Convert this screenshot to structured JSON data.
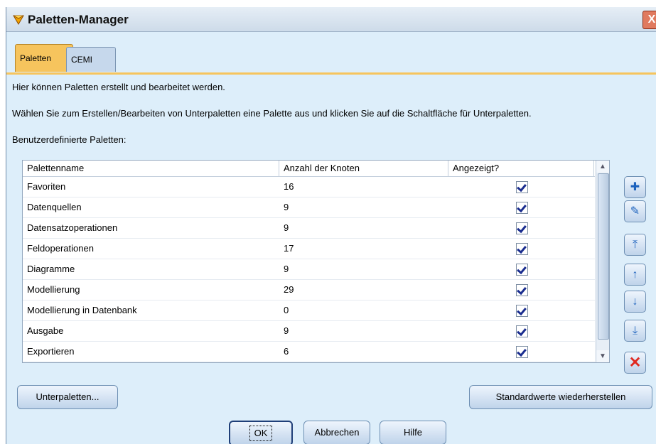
{
  "window": {
    "title": "Paletten-Manager",
    "close_label": "X"
  },
  "tabs": [
    {
      "label": "Paletten"
    },
    {
      "label": "CEMI"
    }
  ],
  "description": {
    "line1": "Hier können Paletten erstellt und bearbeitet werden.",
    "line2": "Wählen Sie zum Erstellen/Bearbeiten von Unterpaletten eine Palette aus und klicken Sie auf die Schaltfläche für Unterpaletten.",
    "custom_label": "Benutzerdefinierte Paletten:"
  },
  "table": {
    "columns": [
      "Palettenname",
      "Anzahl der Knoten",
      "Angezeigt?"
    ],
    "rows": [
      {
        "name": "Favoriten",
        "count": "16",
        "shown": true
      },
      {
        "name": "Datenquellen",
        "count": "9",
        "shown": true
      },
      {
        "name": "Datensatzoperationen",
        "count": "9",
        "shown": true
      },
      {
        "name": "Feldoperationen",
        "count": "17",
        "shown": true
      },
      {
        "name": "Diagramme",
        "count": "9",
        "shown": true
      },
      {
        "name": "Modellierung",
        "count": "29",
        "shown": true
      },
      {
        "name": "Modellierung in Datenbank",
        "count": "0",
        "shown": true
      },
      {
        "name": "Ausgabe",
        "count": "9",
        "shown": true
      },
      {
        "name": "Exportieren",
        "count": "6",
        "shown": true
      }
    ]
  },
  "side_buttons": [
    {
      "name": "add-palette-icon",
      "glyph": "✚"
    },
    {
      "name": "edit-palette-icon",
      "glyph": "✎"
    },
    {
      "name": "move-top-icon",
      "glyph": "⤒"
    },
    {
      "name": "move-up-icon",
      "glyph": "↑"
    },
    {
      "name": "move-down-icon",
      "glyph": "↓"
    },
    {
      "name": "move-bottom-icon",
      "glyph": "⤓"
    },
    {
      "name": "delete-icon",
      "glyph": "✕"
    }
  ],
  "buttons": {
    "subpalettes": "Unterpaletten...",
    "restore_defaults": "Standardwerte wiederherstellen",
    "ok": "OK",
    "cancel": "Abbrechen",
    "help": "Hilfe"
  }
}
